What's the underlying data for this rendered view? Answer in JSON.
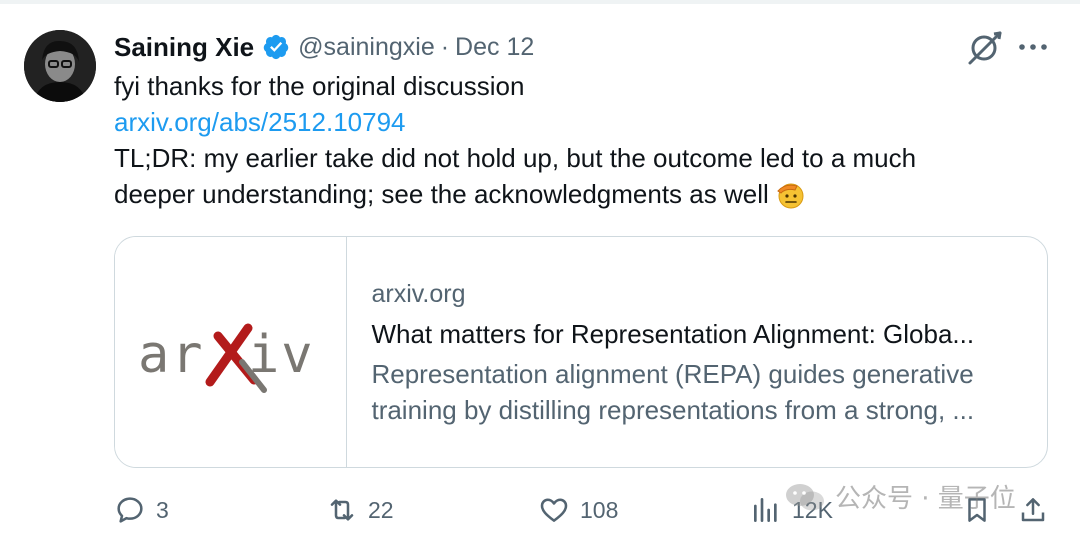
{
  "tweet": {
    "author": {
      "display_name": "Saining Xie",
      "handle": "@sainingxie",
      "separator": "·",
      "date": "Dec 12",
      "verified": true
    },
    "text_lines": [
      "fyi thanks for the original discussion",
      "arxiv.org/abs/2512.10794",
      "TL;DR: my earlier take did not hold up, but the outcome led to a much",
      "deeper understanding; see the acknowledgments as well"
    ],
    "emoji": "saluting-face"
  },
  "card": {
    "logo_text": "arXiv",
    "domain": "arxiv.org",
    "title": "What matters for Representation Alignment: Globa...",
    "description_lines": [
      "Representation alignment (REPA) guides generative",
      "training by distilling representations from a strong, ..."
    ]
  },
  "actions": {
    "replies": "3",
    "retweets": "22",
    "likes": "108",
    "views": "12K"
  },
  "watermark": {
    "text": "公众号 · 量子位"
  },
  "colors": {
    "text": "#0f1419",
    "secondary": "#536471",
    "link": "#1d9bf0",
    "verified": "#1d9bf0",
    "border": "#cfd9de",
    "arxiv_red": "#b31b1b",
    "arxiv_gray": "#7a7772"
  },
  "icons": [
    "grok-icon",
    "more-icon",
    "reply-icon",
    "retweet-icon",
    "like-icon",
    "views-icon",
    "bookmark-icon",
    "share-icon",
    "verified-badge-icon"
  ]
}
